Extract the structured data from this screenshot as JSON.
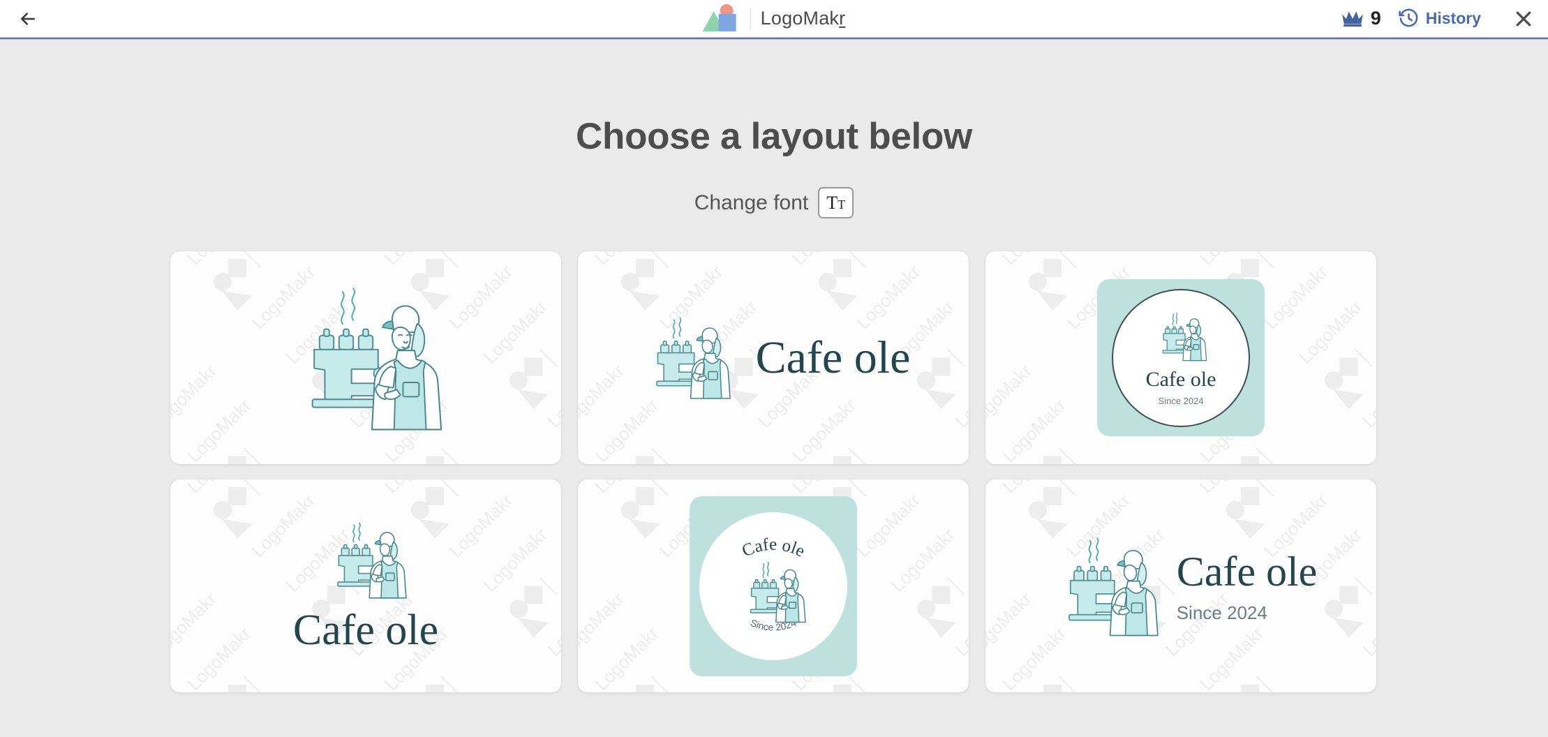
{
  "header": {
    "back_icon": "arrow-left-icon",
    "brand": {
      "name_main": "LogoMak",
      "name_underlined": "r",
      "mark_triangle_color": "#8ed3ad",
      "mark_circle_color": "#ef9585",
      "mark_square_color": "#7fa6de"
    },
    "crown_icon": "crown-icon",
    "credits": "9",
    "history_icon": "history-clock-icon",
    "history_label": "History",
    "close_icon": "close-icon",
    "divider_color": "#5b76ad"
  },
  "main": {
    "title": "Choose a layout below",
    "font_label": "Change font",
    "font_button_glyph_large": "T",
    "font_button_glyph_small": "T"
  },
  "watermark": {
    "text": "LogoMakr",
    "color": "#e8e8e8"
  },
  "logo": {
    "name": "Cafe ole",
    "tagline": "Since 2024",
    "text_color": "#24454b",
    "tagline_color": "#6d7d80",
    "accent_color": "#bfe1de",
    "illustration": "barista-espresso-machine"
  },
  "layouts": [
    {
      "id": "layout-1",
      "style": "icon-only",
      "name": "",
      "tagline": ""
    },
    {
      "id": "layout-2",
      "style": "icon-left-text-right",
      "name": "Cafe ole",
      "tagline": ""
    },
    {
      "id": "layout-3",
      "style": "badge-circle-stacked",
      "name": "Cafe ole",
      "tagline": "Since 2024"
    },
    {
      "id": "layout-4",
      "style": "icon-top-text-bottom",
      "name": "Cafe ole",
      "tagline": ""
    },
    {
      "id": "layout-5",
      "style": "badge-arched",
      "name": "Cafe ole",
      "tagline": "Since 2024"
    },
    {
      "id": "layout-6",
      "style": "icon-left-text-tagline",
      "name": "Cafe ole",
      "tagline": "Since 2024"
    }
  ]
}
